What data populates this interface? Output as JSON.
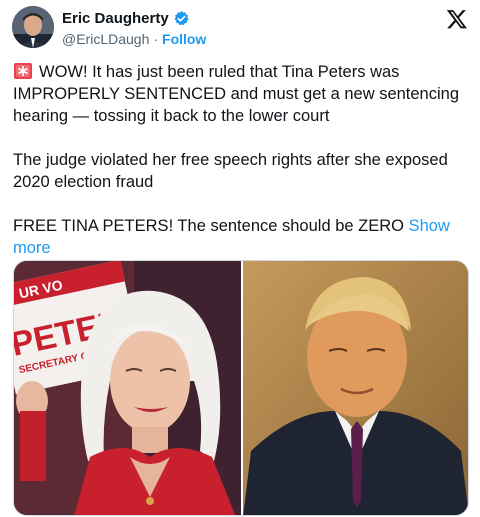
{
  "author": {
    "display_name": "Eric Daugherty",
    "handle": "@EricLDaugh",
    "separator": "·",
    "follow_label": "Follow",
    "verified": true
  },
  "icons": {
    "avatar": "avatar",
    "verified": "verified-badge-icon",
    "platform": "x-logo-icon",
    "alert": "police-light-emoji"
  },
  "tweet": {
    "paragraph_1": "WOW! It has just been ruled that Tina Peters was IMPROPERLY SENTENCED and must get a new sentencing hearing — tossing it back to the lower court",
    "paragraph_2": "The judge violated her free speech rights after she exposed 2020 election fraud",
    "paragraph_3": "FREE TINA PETERS! The sentence should be ZERO",
    "show_more": "Show more"
  },
  "media": {
    "left_sign_text": "PETERS",
    "left_sign_top_text": "UR VO",
    "left_sign_bottom_text": "SECRETARY OF S"
  },
  "colors": {
    "accent": "#1d9bf0",
    "text": "#0f1419",
    "secondary": "#536471",
    "sign_red": "#c8202d"
  }
}
